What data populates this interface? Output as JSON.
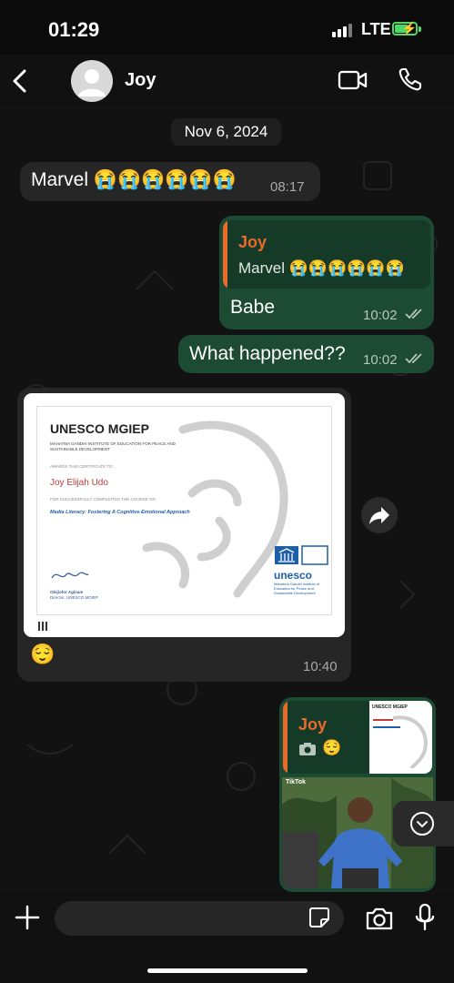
{
  "status_bar": {
    "time": "01:29",
    "network": "LTE"
  },
  "header": {
    "contact_name": "Joy"
  },
  "date_divider": "Nov 6, 2024",
  "messages": [
    {
      "direction": "in",
      "text": "Marvel 😭😭😭😭😭😭",
      "time": "08:17"
    },
    {
      "direction": "out",
      "reply_to_name": "Joy",
      "reply_to_text": "Marvel 😭😭😭😭😭😭",
      "text": "Babe",
      "time": "10:02",
      "status": "read"
    },
    {
      "direction": "out",
      "text": "What happened??",
      "time": "10:02",
      "status": "read"
    },
    {
      "direction": "in",
      "image": {
        "title": "UNESCO MGIEP",
        "subtitle": "MAHATMA GANDHI INSTITUTE OF EDUCATION FOR PEACE AND SUSTAINABLE DEVELOPMENT",
        "awards_line": "AWARDS THIS CERTIFICATE TO",
        "recipient": "Joy Elijah Udo",
        "completing_line": "FOR SUCCESSFULLY COMPLETING THE COURSE ON",
        "course": "Media Literacy: Fostering A Cognitive-Emotional Approach",
        "signer_name": "Obijiofor Aginam",
        "signer_title": "Director, UNESCO MGIEP",
        "logo_word": "unesco",
        "logo_org": "Mahatma Gandhi Institute of Education for Peace and Sustainable Development"
      },
      "caption": "😌",
      "time": "10:40"
    },
    {
      "direction": "out",
      "reply_to_name": "Joy",
      "reply_to_text": "😌",
      "reply_thumb_title": "UNESCO MGIEP",
      "media_label": "TikTok"
    }
  ],
  "input": {
    "placeholder": ""
  },
  "icons": {
    "back": "chevron-left-icon",
    "video": "video-camera-icon",
    "call": "phone-icon",
    "forward": "forward-arrow-icon",
    "scroll_down": "chevron-down-icon",
    "attach": "plus-icon",
    "sticker": "sticker-icon",
    "camera": "camera-icon",
    "mic": "microphone-icon"
  },
  "colors": {
    "incoming_bubble": "#262626",
    "outgoing_bubble": "#1d4a33",
    "quote_accent": "#e96a2b",
    "battery": "#4cd964",
    "course_title": "#1f5fa8",
    "recipient_name": "#c23b3b"
  }
}
